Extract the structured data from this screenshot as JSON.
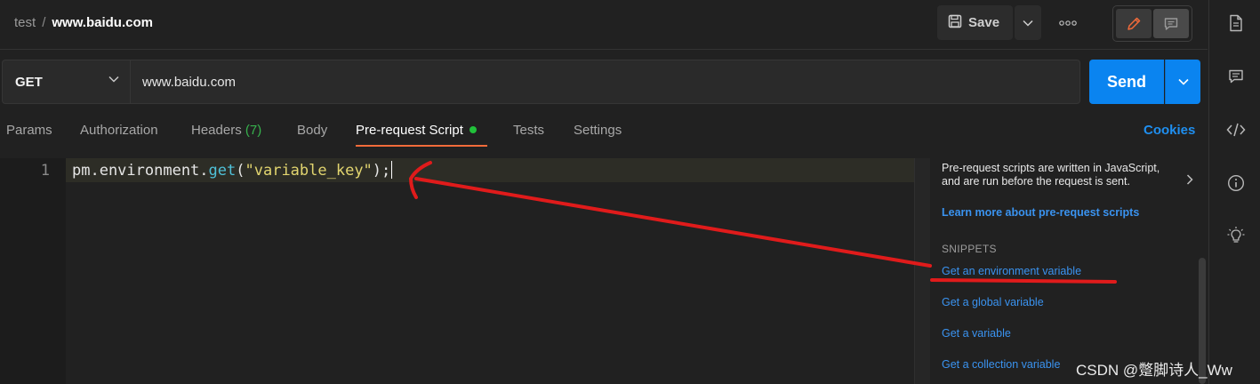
{
  "breadcrumb": {
    "collection": "test",
    "separator": "/",
    "request": "www.baidu.com"
  },
  "toolbar": {
    "save_label": "Save",
    "more_label": "ooo"
  },
  "request": {
    "method": "GET",
    "url": "www.baidu.com",
    "send_label": "Send"
  },
  "tabs": {
    "params": "Params",
    "authorization": "Authorization",
    "headers": "Headers",
    "headers_count": "(7)",
    "body": "Body",
    "prerequest": "Pre-request Script",
    "tests": "Tests",
    "settings": "Settings"
  },
  "cookies_label": "Cookies",
  "editor": {
    "line_number": "1",
    "code": {
      "obj": "pm.environment.",
      "fn": "get",
      "open": "(",
      "str": "\"variable_key\"",
      "close": ");"
    }
  },
  "panel": {
    "description": "Pre-request scripts are written in JavaScript, and are run before the request is sent.",
    "learn_more": "Learn more about pre-request scripts",
    "snippets_heading": "SNIPPETS",
    "snippets": [
      "Get an environment variable",
      "Get a global variable",
      "Get a variable",
      "Get a collection variable"
    ]
  },
  "watermark": "CSDN @蹩脚诗人_Ww",
  "colors": {
    "accent_orange": "#f26b3a",
    "send_blue": "#0a84f0",
    "link_blue": "#3a93f0",
    "status_green": "#21c13a",
    "annotation_red": "#e01b1b"
  },
  "icons": {
    "save": "save-icon",
    "more": "more-icon",
    "edit": "pencil-icon",
    "comment": "comment-icon",
    "doc": "document-icon",
    "code": "code-icon",
    "info": "info-icon",
    "bulb": "lightbulb-icon"
  }
}
